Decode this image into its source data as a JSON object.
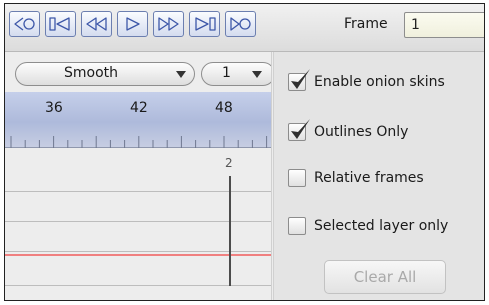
{
  "toolbar": {
    "buttons": [
      {
        "name": "first-frame",
        "icon": "first-frame-icon"
      },
      {
        "name": "previous-keyframe",
        "icon": "previous-keyframe-icon"
      },
      {
        "name": "step-backward",
        "icon": "step-backward-icon"
      },
      {
        "name": "play",
        "icon": "play-icon"
      },
      {
        "name": "step-forward",
        "icon": "step-forward-icon"
      },
      {
        "name": "next-keyframe",
        "icon": "next-keyframe-icon"
      },
      {
        "name": "last-frame",
        "icon": "last-frame-icon"
      }
    ],
    "frame_label": "Frame",
    "frame_value": "1"
  },
  "timeline": {
    "interpolation": "Smooth",
    "step": "1",
    "ruler_labels": [
      "36",
      "42",
      "48"
    ],
    "onion_marker": "2",
    "accent_color": "#aebadb",
    "guide_line_color": "#f08080"
  },
  "options": [
    {
      "label": "Enable onion skins",
      "checked": true
    },
    {
      "label": "Outlines Only",
      "checked": true
    },
    {
      "label": "Relative frames",
      "checked": false
    },
    {
      "label": "Selected layer only",
      "checked": false
    }
  ],
  "clear_all": {
    "label": "Clear All",
    "enabled": false
  }
}
